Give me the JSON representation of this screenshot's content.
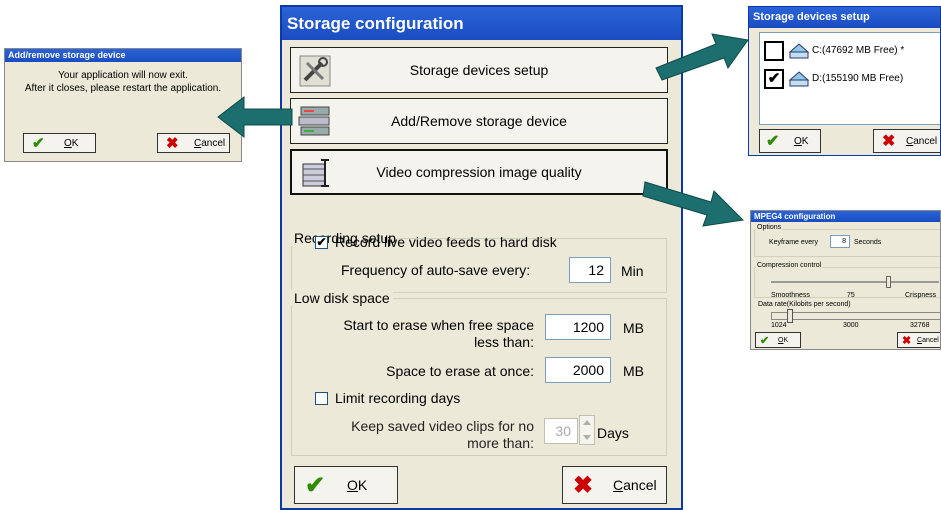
{
  "main": {
    "title": "Storage configuration",
    "nav_buttons": [
      {
        "label": "Storage devices setup",
        "icon": "tools-icon"
      },
      {
        "label": "Add/Remove storage device",
        "icon": "drive-stack-icon"
      },
      {
        "label": "Video compression image quality",
        "icon": "compress-icon"
      }
    ],
    "recording": {
      "group_label": "Recording setup",
      "record_live_label": "Record live video feeds to hard disk",
      "record_live_checked": true,
      "autosave_label": "Frequency of auto-save every:",
      "autosave_value": "12",
      "autosave_unit": "Min"
    },
    "low_disk": {
      "group_label": "Low disk space",
      "erase_start_label_1": "Start to erase when free space",
      "erase_start_label_2": "less than:",
      "erase_start_value": "1200",
      "erase_start_unit": "MB",
      "erase_once_label": "Space to erase at once:",
      "erase_once_value": "2000",
      "erase_once_unit": "MB",
      "limit_days_label": "Limit recording days",
      "limit_days_checked": false,
      "keep_label_1": "Keep saved video clips for no",
      "keep_label_2": "more than:",
      "keep_value": "30",
      "keep_unit": "Days"
    },
    "ok": {
      "hot": "O",
      "rest": "K"
    },
    "cancel": {
      "hot": "C",
      "rest": "ancel"
    }
  },
  "left": {
    "title": "Add/remove storage device",
    "message_1": "Your application will now exit.",
    "message_2": "After it closes, please restart the application.",
    "ok": {
      "hot": "O",
      "rest": "K"
    },
    "cancel": {
      "hot": "C",
      "rest": "ancel"
    }
  },
  "devices": {
    "title": "Storage devices setup",
    "items": [
      {
        "label": "C:(47692 MB Free) *",
        "checked": false
      },
      {
        "label": "D:(155190 MB Free)",
        "checked": true
      }
    ],
    "ok": {
      "hot": "O",
      "rest": "K"
    },
    "cancel": {
      "hot": "C",
      "rest": "ancel"
    }
  },
  "mpeg": {
    "title": "MPEG4 configuration",
    "options_label": "Options",
    "keyframe_label": "Keyframe every",
    "keyframe_value": "8",
    "keyframe_unit": "Seconds",
    "compression_label": "Compression control",
    "smoothness_label": "Smoothness",
    "compression_value": "75",
    "crispness_label": "Crispness",
    "datarate_label": "Data rate(Kilobits per second)",
    "rate_min": "1024",
    "rate_mid": "3000",
    "rate_max": "32768",
    "ok": {
      "hot": "O",
      "rest": "K"
    },
    "cancel": {
      "hot": "C",
      "rest": "ancel"
    }
  },
  "colors": {
    "title_blue": "#1a4cc0",
    "arrow_teal": "#1d6e6e",
    "dialog_bg": "#ece9d8",
    "check_green": "#2e8b00",
    "cancel_red": "#cc0000"
  }
}
